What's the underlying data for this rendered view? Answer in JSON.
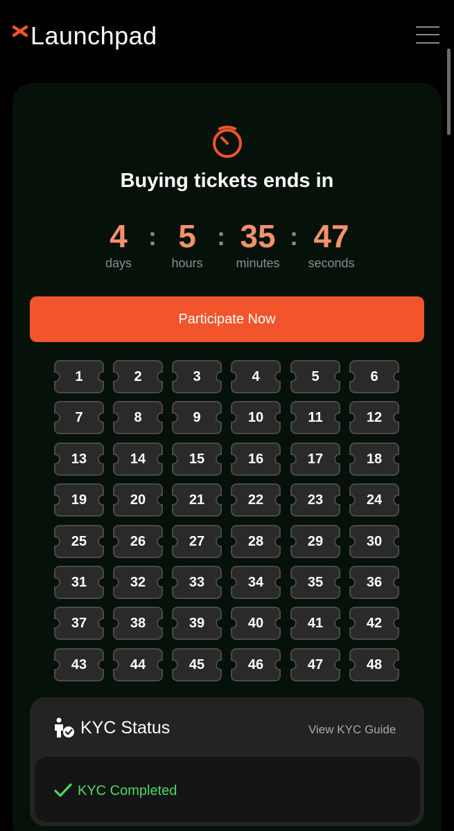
{
  "header": {
    "brand": "Launchpad",
    "brand_color": "#f2552c"
  },
  "countdown": {
    "title": "Buying tickets ends in",
    "separator": ":",
    "units": [
      {
        "value": "4",
        "label": "days"
      },
      {
        "value": "5",
        "label": "hours"
      },
      {
        "value": "35",
        "label": "minutes"
      },
      {
        "value": "47",
        "label": "seconds"
      }
    ],
    "value_color": "#f4916b"
  },
  "cta": {
    "label": "Participate Now",
    "color": "#f2552c"
  },
  "tickets": {
    "columns": 6,
    "items": [
      "1",
      "2",
      "3",
      "4",
      "5",
      "6",
      "7",
      "8",
      "9",
      "10",
      "11",
      "12",
      "13",
      "14",
      "15",
      "16",
      "17",
      "18",
      "19",
      "20",
      "21",
      "22",
      "23",
      "24",
      "25",
      "26",
      "27",
      "28",
      "29",
      "30",
      "31",
      "32",
      "33",
      "34",
      "35",
      "36",
      "37",
      "38",
      "39",
      "40",
      "41",
      "42",
      "43",
      "44",
      "45",
      "46",
      "47",
      "48"
    ]
  },
  "kyc": {
    "title": "KYC Status",
    "guide_link": "View KYC Guide",
    "status": "KYC Completed",
    "status_color": "#4cd964"
  }
}
